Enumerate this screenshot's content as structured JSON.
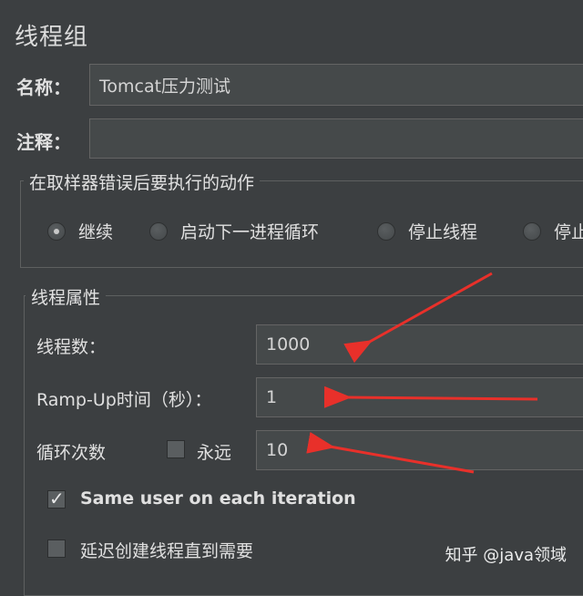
{
  "panel": {
    "title": "线程组"
  },
  "name_field": {
    "label": "名称：",
    "value": "Tomcat压力测试"
  },
  "comment_field": {
    "label": "注释：",
    "value": ""
  },
  "error_action": {
    "title": "在取样器错误后要执行的动作",
    "options": [
      {
        "label": "继续",
        "selected": true
      },
      {
        "label": "启动下一进程循环",
        "selected": false
      },
      {
        "label": "停止线程",
        "selected": false
      },
      {
        "label": "停止",
        "selected": false
      }
    ]
  },
  "thread_props": {
    "title": "线程属性",
    "threads_label": "线程数：",
    "threads_value": "1000",
    "rampup_label": "Ramp-Up时间（秒）：",
    "rampup_value": "1",
    "loop_label": "循环次数",
    "forever_label": "永远",
    "forever_checked": false,
    "loop_value": "10",
    "same_user_label": "Same user on each iteration",
    "same_user_checked": true,
    "delay_label": "延迟创建线程直到需要",
    "delay_checked": false
  },
  "annotation_color": "#e8302a",
  "watermark": "知乎 @java领域"
}
